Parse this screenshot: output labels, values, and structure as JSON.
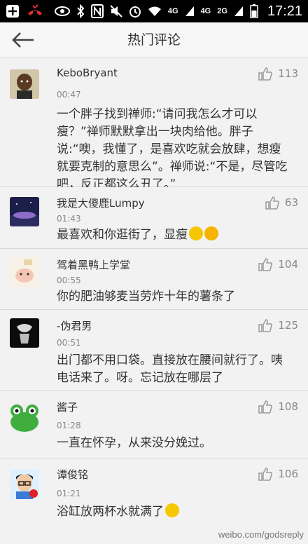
{
  "status_bar": {
    "network_labels": [
      "4G",
      "4G",
      "2G"
    ],
    "time": "17:21"
  },
  "header": {
    "title": "热门评论"
  },
  "comments": [
    {
      "username": "KeboBryant",
      "time": "00:47",
      "likes": "113",
      "text": "一个胖子找到禅师:“请问我怎么才可以瘦？”禅师默默拿出一块肉给他。胖子说:“噢，我懂了，是喜欢吃就会放肆，想瘦就要克制的意思么”。禅师说:“不是，尽管吃吧，反正都这么丑了。”"
    },
    {
      "username": "我是大傻鹿Lumpy",
      "time": "01:43",
      "likes": "63",
      "text": "最喜欢和你逛街了，显瘦"
    },
    {
      "username": "驾着黑鸭上学堂",
      "time": "00:55",
      "likes": "104",
      "text": "你的肥油够麦当劳炸十年的薯条了"
    },
    {
      "username": "-伪君男",
      "time": "00:51",
      "likes": "125",
      "text": "出门都不用口袋。直接放在腰间就行了。咦电话来了。呀。忘记放在哪层了"
    },
    {
      "username": "酱子",
      "time": "01:28",
      "likes": "108",
      "text": "一直在怀孕，从来没分娩过。"
    },
    {
      "username": "谭俊铭",
      "time": "01:21",
      "likes": "106",
      "text": "浴缸放两杯水就满了"
    }
  ],
  "watermark": {
    "text": "weibo.com/godsreply"
  },
  "colors": {
    "background": "#f2f2f2",
    "statusbar": "#000000",
    "text": "#333333",
    "secondary_text": "#888888"
  }
}
